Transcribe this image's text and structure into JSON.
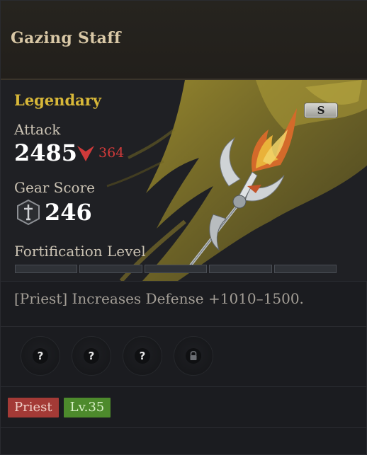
{
  "item": {
    "name": "Gazing Staff",
    "rarity": "Legendary",
    "tier_badge": "S",
    "attack_label": "Attack",
    "attack_value": "2485",
    "attack_delta": "364",
    "gear_score_label": "Gear Score",
    "gear_score_value": "246",
    "fortification_label": "Fortification Level",
    "fortification_segments": 5,
    "fortification_filled": 0,
    "effect_text": "[Priest] Increases Defense +1010–1500.",
    "slots": [
      {
        "state": "unknown",
        "symbol": "?"
      },
      {
        "state": "unknown",
        "symbol": "?"
      },
      {
        "state": "unknown",
        "symbol": "?"
      },
      {
        "state": "locked",
        "icon": "lock-icon"
      }
    ],
    "tags": {
      "class": "Priest",
      "level": "Lv.35"
    }
  },
  "colors": {
    "rarity": "#d8b839",
    "attack_delta": "#d03a3a",
    "class_tag": "#a33a36",
    "level_tag": "#4d8a2c"
  }
}
